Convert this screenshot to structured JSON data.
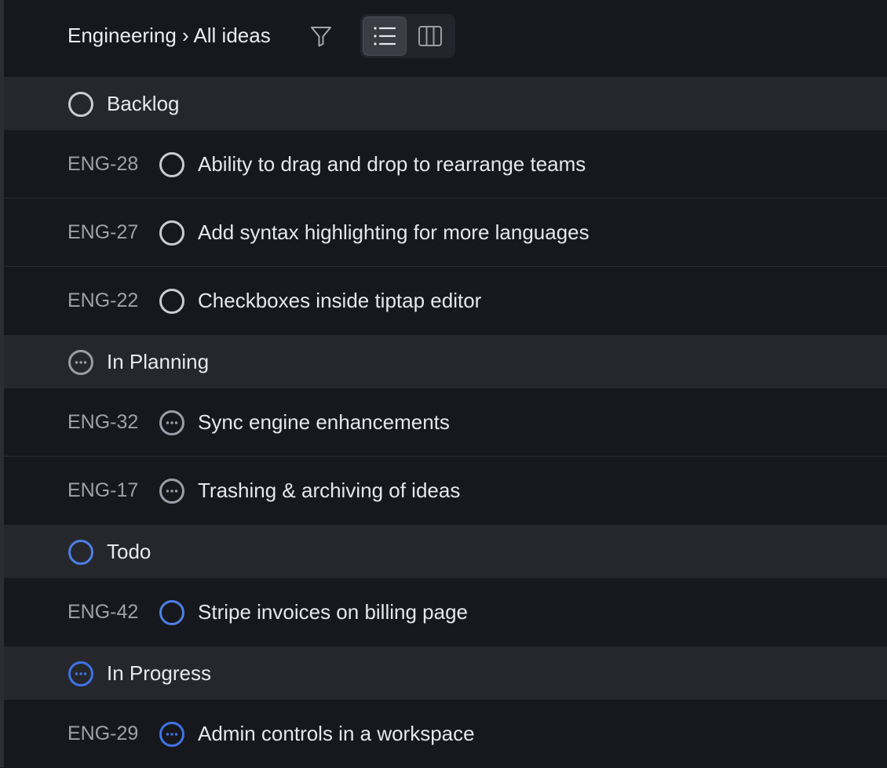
{
  "header": {
    "breadcrumb": "Engineering › All ideas",
    "filter_icon": "filter-icon",
    "view_options": [
      "list-view-icon",
      "board-view-icon"
    ],
    "active_view": "list"
  },
  "colors": {
    "backlog": "#c9ccd3",
    "in_planning": "#9a9ea8",
    "todo": "#4d7fe6",
    "in_progress": "#3f73e6"
  },
  "groups": [
    {
      "label": "Backlog",
      "status": "backlog",
      "items": [
        {
          "id": "ENG-28",
          "title": "Ability to drag and drop to rearrange teams"
        },
        {
          "id": "ENG-27",
          "title": "Add syntax highlighting for more languages"
        },
        {
          "id": "ENG-22",
          "title": "Checkboxes inside tiptap editor"
        }
      ]
    },
    {
      "label": "In Planning",
      "status": "in_planning",
      "items": [
        {
          "id": "ENG-32",
          "title": "Sync engine enhancements"
        },
        {
          "id": "ENG-17",
          "title": "Trashing & archiving of ideas"
        }
      ]
    },
    {
      "label": "Todo",
      "status": "todo",
      "items": [
        {
          "id": "ENG-42",
          "title": "Stripe invoices on billing page"
        }
      ]
    },
    {
      "label": "In Progress",
      "status": "in_progress",
      "items": [
        {
          "id": "ENG-29",
          "title": "Admin controls in a workspace"
        }
      ]
    }
  ]
}
